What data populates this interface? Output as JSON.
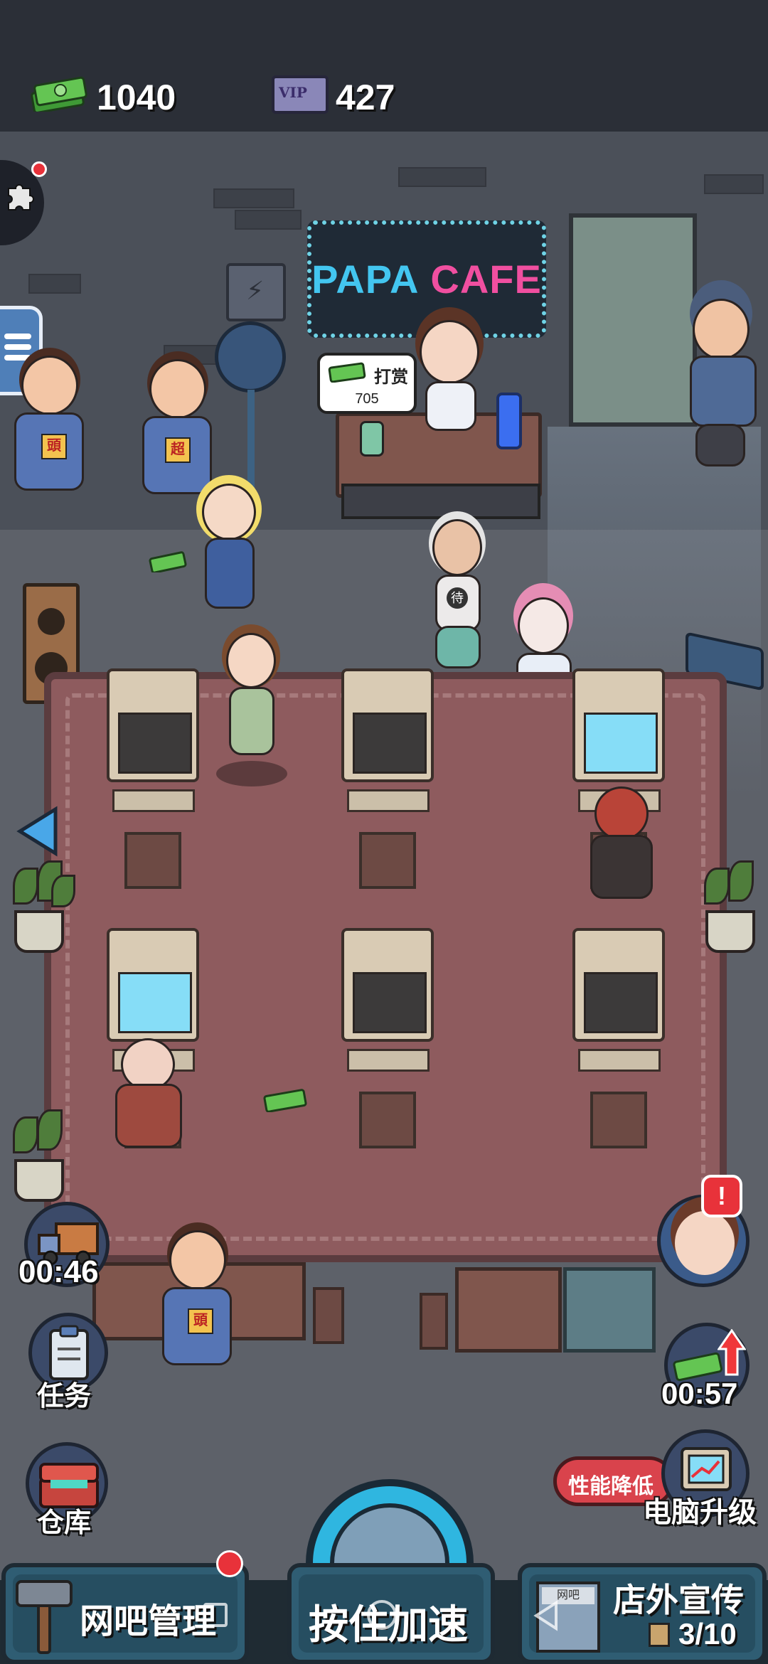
{
  "hud": {
    "cash_amount": "1040",
    "vip_amount": "427",
    "vip_badge": "VIP",
    "delivery_timer": "00:46",
    "tasks_label": "任务",
    "warehouse_label": "仓库",
    "cash_boost_timer": "00:57",
    "performance_badge": "性能降低",
    "pc_upgrade_label": "电脑升级"
  },
  "scene": {
    "sign_left": "PAPA",
    "sign_right": "CAFE",
    "tip_label": "打赏",
    "tip_amount": "705",
    "hero_shirt_1": "頭",
    "hero_shirt_2": "超",
    "hero_shirt_3": "頭",
    "elder_shirt": "待"
  },
  "bottom_bar": {
    "manage_label": "网吧管理",
    "speed_label": "按住加速",
    "promo_label": "店外宣传",
    "promo_progress": "3/10",
    "promo_shop_sign": "网吧"
  },
  "colors": {
    "cash_green": "#5fbf4a",
    "alert_red": "#e8323a",
    "screen_on": "#86ddf7",
    "neon_cyan": "#43c6f0",
    "neon_pink": "#f04fa0"
  },
  "icons": {
    "cash": "cash-stack-icon",
    "vip": "vip-card-icon",
    "puzzle": "puzzle-icon",
    "menu": "hamburger-menu-icon",
    "left_arrow": "left-arrow-icon",
    "truck": "delivery-truck-icon",
    "clipboard": "clipboard-icon",
    "chest": "chest-icon",
    "upgrade": "up-arrow-icon",
    "hammer": "hammer-icon"
  }
}
